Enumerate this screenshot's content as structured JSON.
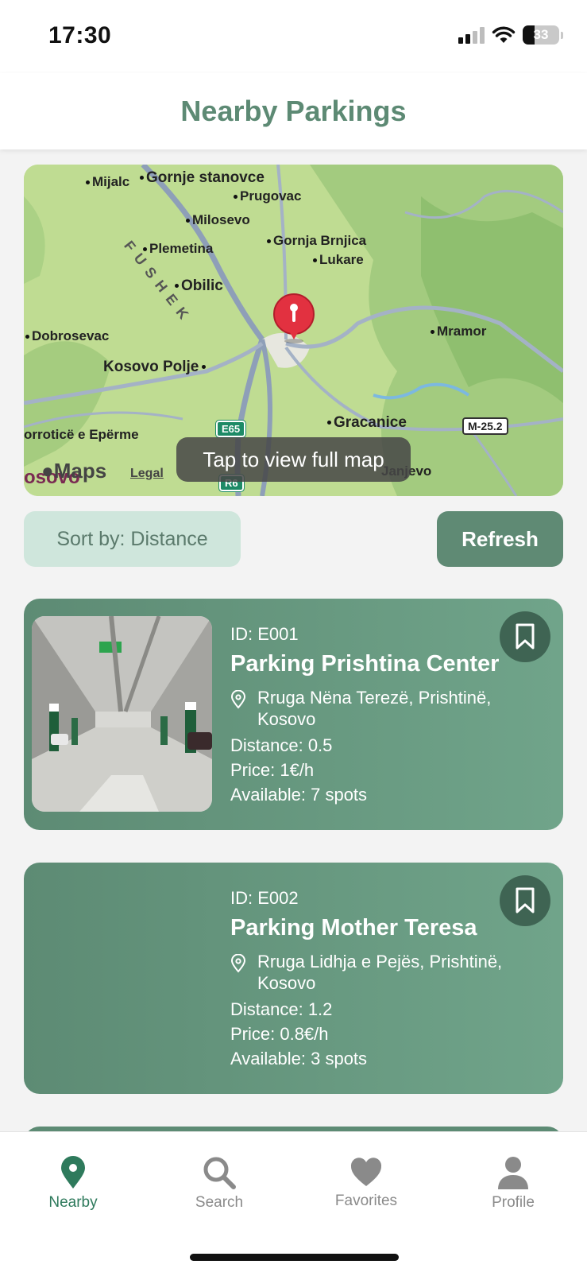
{
  "status_bar": {
    "time": "17:30",
    "battery": "33"
  },
  "header": {
    "title": "Nearby Parkings"
  },
  "map": {
    "labels": {
      "mijalc": "Mijalc",
      "gornje_stanovce": "Gornje stanovce",
      "prugovac": "Prugovac",
      "milosevo": "Milosevo",
      "plemetina": "Plemetina",
      "gornja_brnjica": "Gornja Brnjica",
      "lukare": "Lukare",
      "obilic": "Obilic",
      "dobrosevac": "Dobrosevac",
      "mramor": "Mramor",
      "kosovo_polje": "Kosovo Polje",
      "mitrovice": "orroticë e Epërme",
      "gracanice": "Gracanice",
      "janjevo": "Janjevo",
      "kosovo": "osovo",
      "fushe": "F U S H E  K"
    },
    "roads": {
      "e65": "E65",
      "r6": "R6",
      "m25": "M-25.2"
    },
    "brand": "Maps",
    "legal": "Legal",
    "toast": "Tap to view full map"
  },
  "controls": {
    "sort_label": "Sort by: Distance",
    "refresh_label": "Refresh"
  },
  "parkings": [
    {
      "id": "ID: E001",
      "name": "Parking Prishtina Center",
      "address": "Rruga Nëna Terezë, Prishtinë, Kosovo",
      "distance": "Distance: 0.5",
      "price": "Price: 1€/h",
      "available": "Available: 7 spots"
    },
    {
      "id": "ID: E002",
      "name": "Parking Mother Teresa",
      "address": "Rruga Lidhja e Pejës, Prishtinë, Kosovo",
      "distance": "Distance: 1.2",
      "price": "Price: 0.8€/h",
      "available": "Available: 3 spots"
    }
  ],
  "tabs": [
    {
      "label": "Nearby",
      "icon": "location-pin-icon",
      "active": true
    },
    {
      "label": "Search",
      "icon": "search-icon",
      "active": false
    },
    {
      "label": "Favorites",
      "icon": "heart-icon",
      "active": false
    },
    {
      "label": "Profile",
      "icon": "person-icon",
      "active": false
    }
  ],
  "colors": {
    "accent": "#5d8a74",
    "card": "#5d8b74",
    "active_tab": "#2e7a5c",
    "sort_bg": "#cfe6dc"
  }
}
